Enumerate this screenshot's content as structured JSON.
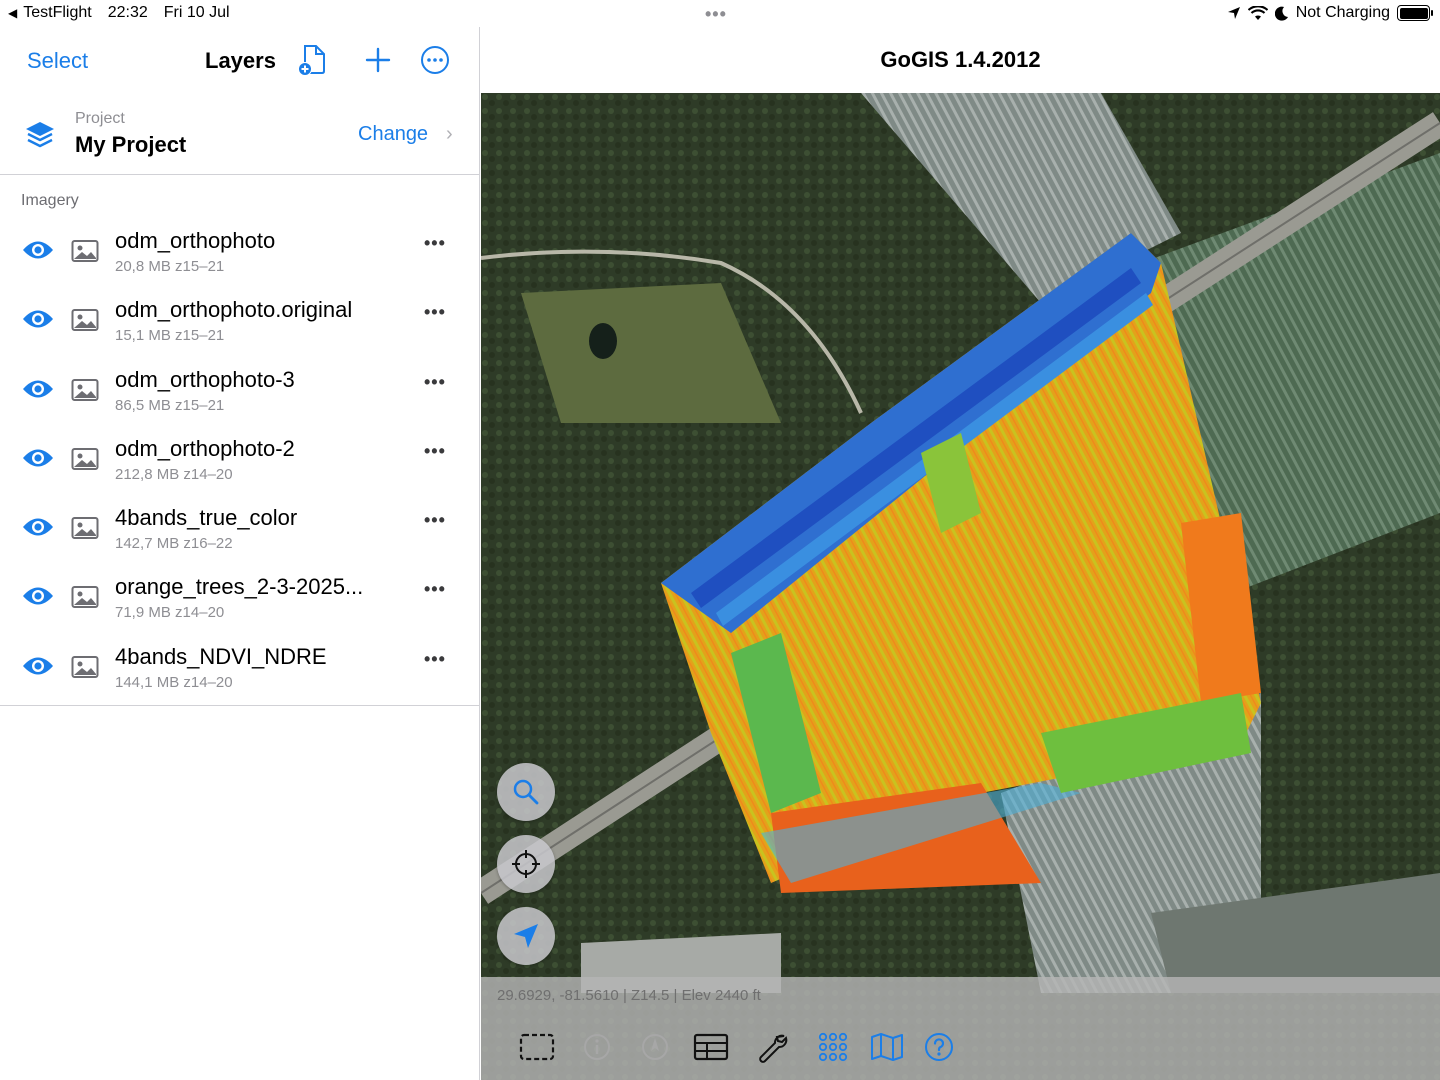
{
  "status_bar": {
    "back_app": "TestFlight",
    "time": "22:32",
    "date": "Fri 10 Jul",
    "battery_status": "Not Charging"
  },
  "sidebar": {
    "select_label": "Select",
    "title": "Layers",
    "project": {
      "caption": "Project",
      "name": "My Project",
      "change_label": "Change"
    },
    "section_label": "Imagery",
    "layers": [
      {
        "name": "odm_orthophoto",
        "size": "20,8 MB",
        "zoom": "z15–21",
        "visible": true
      },
      {
        "name": "odm_orthophoto.original",
        "size": "15,1 MB",
        "zoom": "z15–21",
        "visible": true
      },
      {
        "name": "odm_orthophoto-3",
        "size": "86,5 MB",
        "zoom": "z15–21",
        "visible": true
      },
      {
        "name": "odm_orthophoto-2",
        "size": "212,8 MB",
        "zoom": "z14–20",
        "visible": true
      },
      {
        "name": "4bands_true_color",
        "size": "142,7 MB",
        "zoom": "z16–22",
        "visible": true
      },
      {
        "name": "orange_trees_2-3-2025...",
        "size": "71,9 MB",
        "zoom": "z14–20",
        "visible": true
      },
      {
        "name": "4bands_NDVI_NDRE",
        "size": "144,1 MB",
        "zoom": "z14–20",
        "visible": true
      }
    ]
  },
  "main": {
    "title": "GoGIS 1.4.2012",
    "coords": "29.6929, -81.5610 | Z14.5 | Elev 2440 ft"
  },
  "colors": {
    "accent": "#1b7ee8",
    "separator": "#d1d1d6",
    "secondary_text": "#8e8e93"
  }
}
